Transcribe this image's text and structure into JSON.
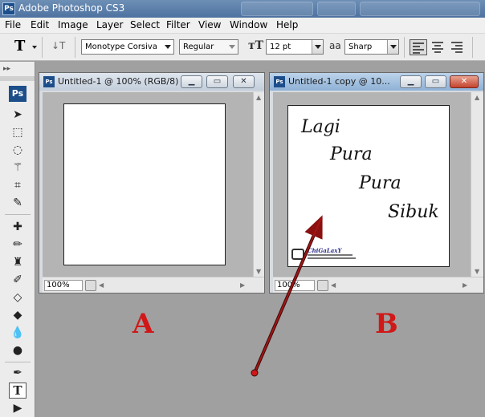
{
  "app": {
    "title": "Adobe Photoshop CS3",
    "logo": "Ps"
  },
  "menu": [
    "File",
    "Edit",
    "Image",
    "Layer",
    "Select",
    "Filter",
    "View",
    "Window",
    "Help"
  ],
  "options": {
    "tool_glyph": "T",
    "font_family": "Monotype Corsiva",
    "font_style": "Regular",
    "font_size": "12 pt",
    "antialias": "Sharp"
  },
  "toolbox": {
    "logo": "Ps"
  },
  "doc_a": {
    "title": "Untitled-1 @ 100% (RGB/8)",
    "zoom": "100%",
    "logo": "Ps"
  },
  "doc_b": {
    "title": "Untitled-1 copy @ 10...",
    "zoom": "100%",
    "logo": "Ps",
    "lines": [
      "Lagi",
      "Pura",
      "Pura",
      "Sibuk"
    ],
    "watermark_title": "ChiGaLaxY"
  },
  "labels": {
    "a": "A",
    "b": "B"
  },
  "colors": {
    "annotation": "#d01818",
    "arrow": "#8b1010"
  }
}
